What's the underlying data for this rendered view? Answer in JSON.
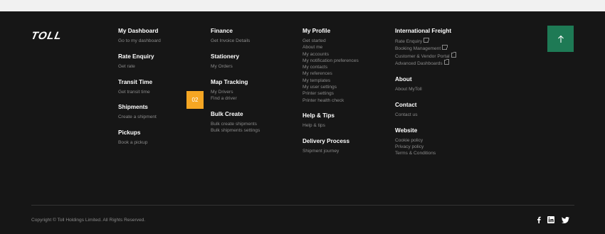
{
  "logo": {
    "text": "TOLL"
  },
  "badge": "02",
  "columns": {
    "c1": [
      {
        "title": "My Dashboard",
        "links": [
          "Go to my dashboard"
        ]
      },
      {
        "title": "Rate Enquiry",
        "links": [
          "Get rate"
        ]
      },
      {
        "title": "Transit Time",
        "links": [
          "Get transit time"
        ]
      },
      {
        "title": "Shipments",
        "links": [
          "Create a shipment"
        ]
      },
      {
        "title": "Pickups",
        "links": [
          "Book a pickup"
        ]
      }
    ],
    "c2": [
      {
        "title": "Finance",
        "links": [
          "Get Invoice Details"
        ]
      },
      {
        "title": "Stationery",
        "links": [
          "My Orders"
        ]
      },
      {
        "title": "Map Tracking",
        "links": [
          "My Drivers",
          "Find a driver"
        ]
      },
      {
        "title": "Bulk Create",
        "links": [
          "Bulk create shipments",
          "Bulk shipments settings"
        ]
      }
    ],
    "c3": [
      {
        "title": "My Profile",
        "links": [
          "Get started",
          "About me",
          "My accounts",
          "My notification preferences",
          "My contacts",
          "My references",
          "My templates",
          "My user settings",
          "Printer settings",
          "Printer health check"
        ]
      },
      {
        "title": "Help & Tips",
        "links": [
          "Help & tips"
        ]
      },
      {
        "title": "Delivery Process",
        "links": [
          "Shipment journey"
        ]
      }
    ],
    "c4": [
      {
        "title": "International Freight",
        "links": [
          "Rate Enquiry",
          "Booking Management",
          "Customer & Vendor Portal",
          "Advanced Dashboards"
        ]
      },
      {
        "title": "About",
        "links": [
          "About MyToll"
        ]
      },
      {
        "title": "Contact",
        "links": [
          "Contact us"
        ]
      },
      {
        "title": "Website",
        "links": [
          "Cookie policy",
          "Privacy policy",
          "Terms & Conditions"
        ]
      }
    ]
  },
  "copyright": "Copyright © Toll Holdings Limited. All Rights Reserved.",
  "icons": {
    "back_to_top": "arrow-up-icon",
    "social": [
      "facebook-icon",
      "linkedin-icon",
      "twitter-icon"
    ]
  },
  "colors": {
    "footer_bg": "#161616",
    "top_bar": "#f1f1f1",
    "accent_green": "#1e7a55",
    "badge_orange": "#f5a623",
    "link_gray": "#8a8a8a"
  }
}
